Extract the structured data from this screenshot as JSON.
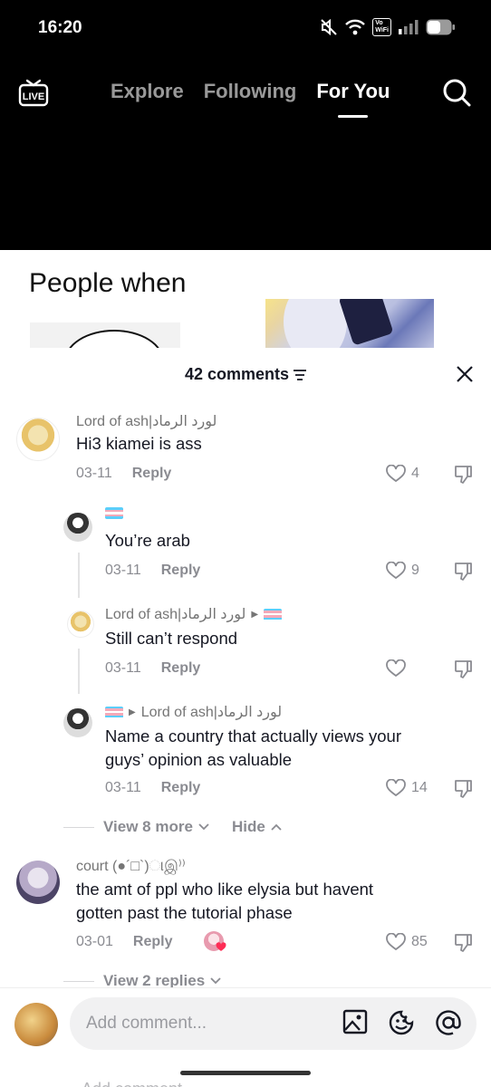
{
  "status_bar": {
    "time": "16:20",
    "vowifi_top": "Vo",
    "vowifi_bottom": "WiFi"
  },
  "nav": {
    "live_label": "LIVE",
    "tabs": [
      {
        "label": "Explore"
      },
      {
        "label": "Following"
      },
      {
        "label": "For You"
      }
    ]
  },
  "video": {
    "caption": "People when"
  },
  "comments": {
    "count_label": "42 comments",
    "items": [
      {
        "user": "Lord of ash|لورد الرماد",
        "text": "Hi3 kiamei is ass",
        "date": "03-11",
        "reply": "Reply",
        "likes": "4"
      },
      {
        "text": "You’re arab",
        "date": "03-11",
        "reply": "Reply",
        "likes": "9"
      },
      {
        "user": "Lord of ash|لورد الرماد",
        "text": "Still can’t respond",
        "date": "03-11",
        "reply": "Reply",
        "likes": ""
      },
      {
        "user_to": "Lord of ash|لورد الرماد",
        "text_line1": "Name a country that actually views your",
        "text_line2": "guys’ opinion as valuable",
        "date": "03-11",
        "reply": "Reply",
        "likes": "14"
      },
      {
        "user": "court (●´□`)ાஇ⁾⁾",
        "text_line1": "the amt of ppl who like elysia but havent",
        "text_line2": "gotten past the tutorial phase",
        "date": "03-01",
        "reply": "Reply",
        "likes": "85"
      }
    ],
    "view_more": "View 8 more",
    "hide": "Hide",
    "view_replies": "View 2 replies"
  },
  "input": {
    "placeholder": "Add comment...",
    "ghost": "Add comment"
  },
  "colors": {
    "trans_blue": "#5BCEFA",
    "trans_pink": "#F5A9B8",
    "heart_red": "#fe2c55"
  }
}
